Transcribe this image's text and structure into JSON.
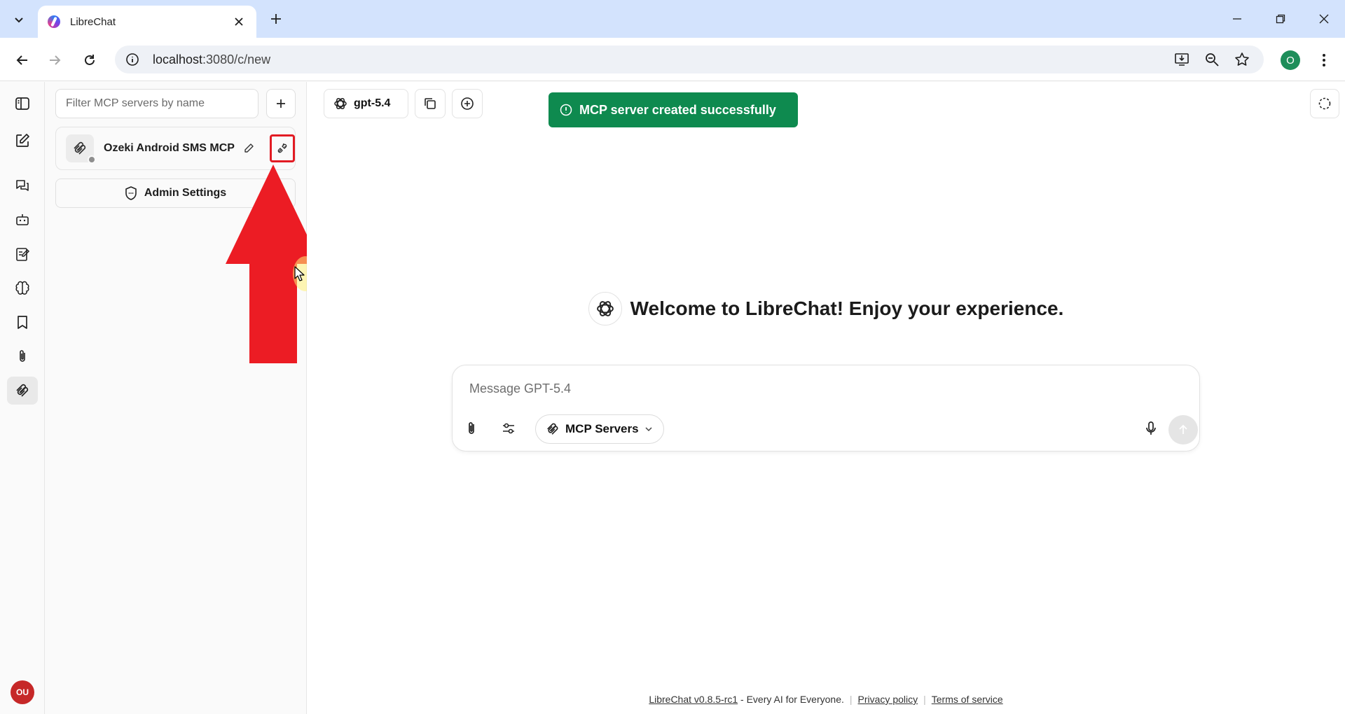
{
  "browser": {
    "tab_title": "LibreChat",
    "url_host": "localhost",
    "url_rest": ":3080/c/new",
    "profile_initial": "O"
  },
  "rail": {
    "items": [
      "toggle-sidebar-icon",
      "new-chat-icon",
      "conversations-icon",
      "agents-icon",
      "prompts-icon",
      "memories-icon",
      "bookmarks-icon",
      "attachments-icon",
      "mcp-servers-icon"
    ],
    "active": "mcp-servers-icon",
    "user_initials": "OU",
    "user_color": "#c62828"
  },
  "panel": {
    "filter_placeholder": "Filter MCP servers by name",
    "server": {
      "name": "Ozeki Android SMS MCP",
      "status_color": "#8e8e8e"
    },
    "admin_label": "Admin Settings",
    "highlight_color": "#e21b23"
  },
  "main": {
    "model_label": "gpt-5.4",
    "toast": {
      "message": "MCP server created successfully",
      "color": "#0e8a4f"
    },
    "welcome": "Welcome to LibreChat! Enjoy your experience.",
    "composer": {
      "placeholder": "Message GPT-5.4",
      "mcp_label": "MCP Servers"
    },
    "footer": {
      "version_link": "LibreChat v0.8.5-rc1",
      "tagline": " - Every AI for Everyone.",
      "privacy": "Privacy policy",
      "terms": "Terms of service"
    }
  }
}
